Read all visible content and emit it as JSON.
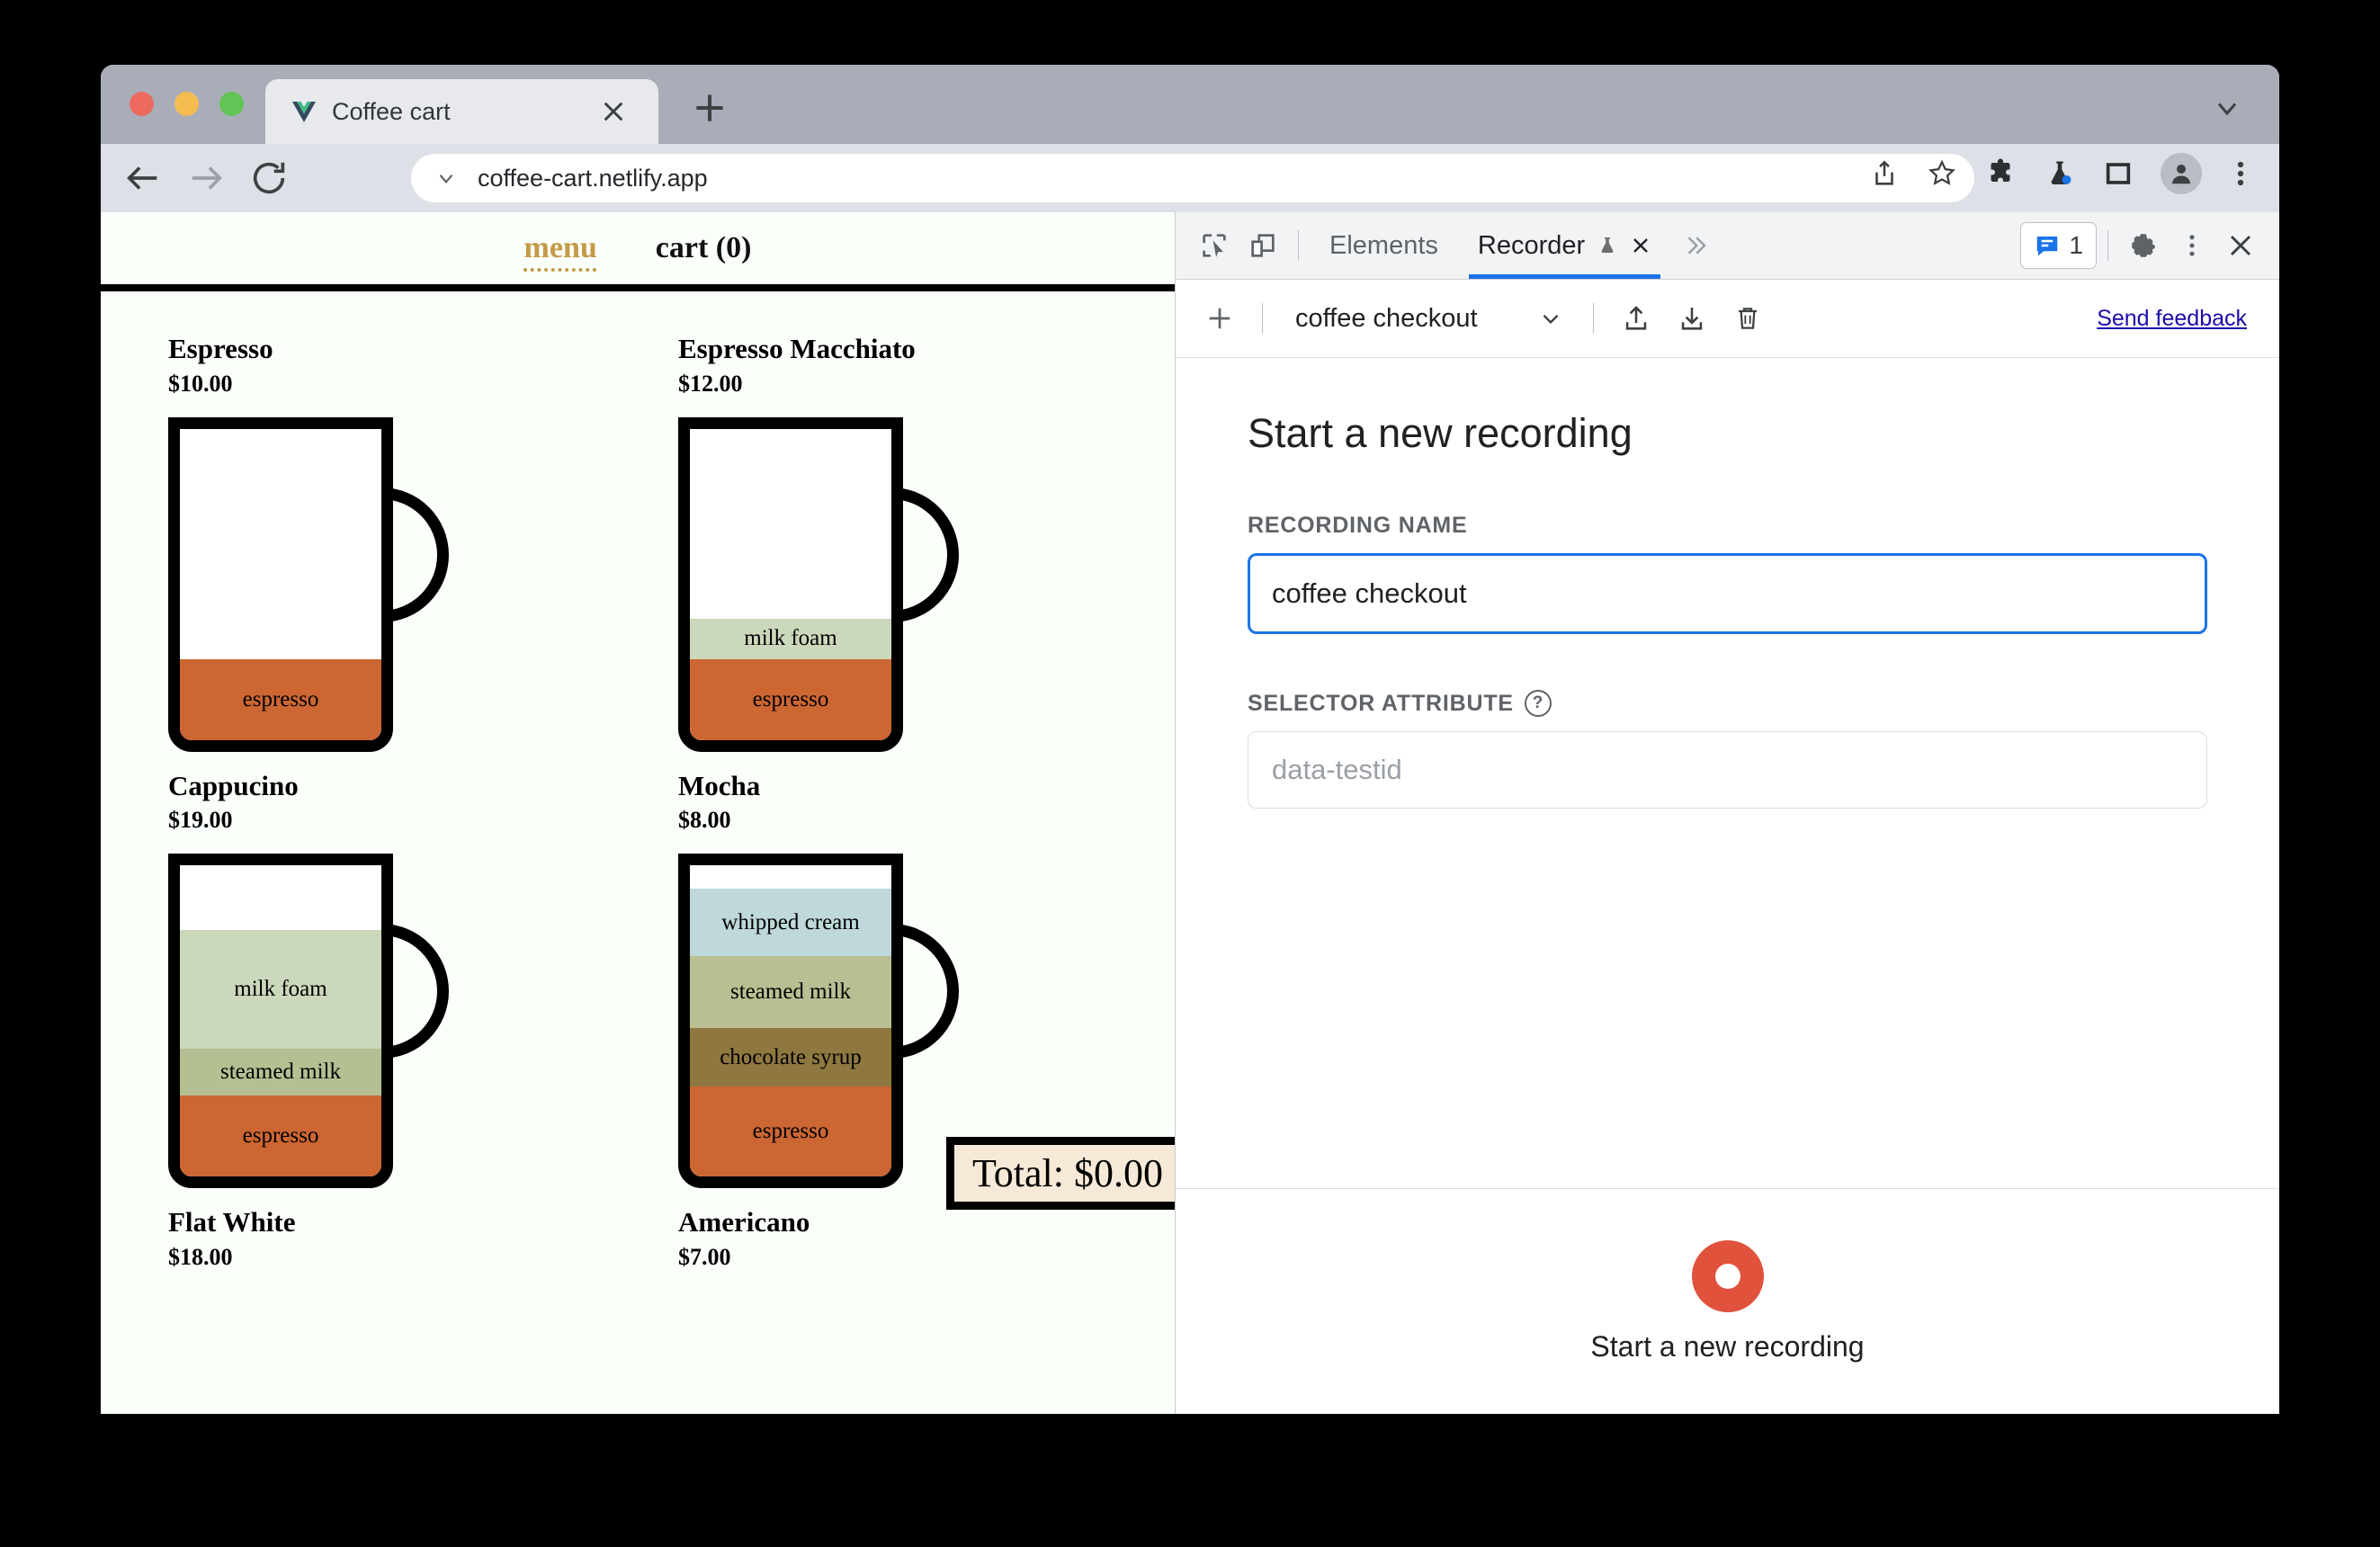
{
  "browser": {
    "tab": {
      "title": "Coffee cart",
      "favicon": "vue-logo-icon"
    },
    "url": "coffee-cart.netlify.app",
    "new_tab_label": "+",
    "toolbar_icons": [
      "back-icon",
      "forward-icon",
      "reload-icon",
      "share-icon",
      "bookmark-star-icon",
      "extensions-puzzle-icon",
      "devtools-flask-icon",
      "side-panel-icon",
      "profile-avatar-icon",
      "chrome-menu-icon"
    ]
  },
  "page": {
    "nav": {
      "menu": "menu",
      "cart": "cart (0)"
    },
    "total_badge": "Total: $0.00",
    "products": [
      {
        "name": "Espresso",
        "price": "$10.00",
        "layers": [
          {
            "label": "",
            "color": "#ffffff",
            "height": 152
          },
          {
            "label": "espresso",
            "color": "#cc6633",
            "height": 90
          }
        ]
      },
      {
        "name": "Espresso Macchiato",
        "price": "$12.00",
        "layers": [
          {
            "label": "",
            "color": "#ffffff",
            "height": 152
          },
          {
            "label": "milk foam",
            "color": "#cbd8bb",
            "height": 45
          },
          {
            "label": "espresso",
            "color": "#cc6633",
            "height": 90
          }
        ]
      },
      {
        "name": "Cappucino",
        "price": "$19.00",
        "layers": [
          {
            "label": "milk foam",
            "color": "#cbd8bb",
            "height": 132
          },
          {
            "label": "steamed milk",
            "color": "#b4bf92",
            "height": 52
          },
          {
            "label": "espresso",
            "color": "#cc6633",
            "height": 90
          }
        ]
      },
      {
        "name": "Mocha",
        "price": "$8.00",
        "layers": [
          {
            "label": "whipped cream",
            "color": "#bfd9da",
            "height": 75
          },
          {
            "label": "steamed milk",
            "color": "#b9bf92",
            "height": 80
          },
          {
            "label": "chocolate syrup",
            "color": "#8e7840",
            "height": 65
          },
          {
            "label": "espresso",
            "color": "#cc6633",
            "height": 100
          }
        ]
      },
      {
        "name": "Flat White",
        "price": "$18.00",
        "layers": []
      },
      {
        "name": "Americano",
        "price": "$7.00",
        "layers": []
      }
    ]
  },
  "devtools": {
    "left_icons": [
      "inspect-element-icon",
      "device-toolbar-icon"
    ],
    "tabs": [
      {
        "label": "Elements",
        "active": false
      },
      {
        "label": "Recorder",
        "active": true,
        "has_flask": true,
        "has_close": true
      }
    ],
    "more_tabs": "»",
    "issues_count": "1",
    "right_icons": [
      "settings-gear-icon",
      "devtools-more-icon",
      "devtools-close-icon"
    ],
    "subbar": {
      "add_label": "+",
      "recording_name": "coffee checkout",
      "dropdown_icon": "chevron-down-icon",
      "import_icon": "import-icon",
      "export_icon": "export-icon",
      "delete_icon": "trash-icon",
      "send_feedback": "Send feedback"
    },
    "form": {
      "heading": "Start a new recording",
      "recording_name_label": "RECORDING NAME",
      "recording_name_value": "coffee checkout",
      "selector_attribute_label": "SELECTOR ATTRIBUTE",
      "selector_attribute_help": "?",
      "selector_attribute_placeholder": "data-testid"
    },
    "footer": {
      "start_label": "Start a new recording",
      "record_color": "#e0523c"
    }
  }
}
